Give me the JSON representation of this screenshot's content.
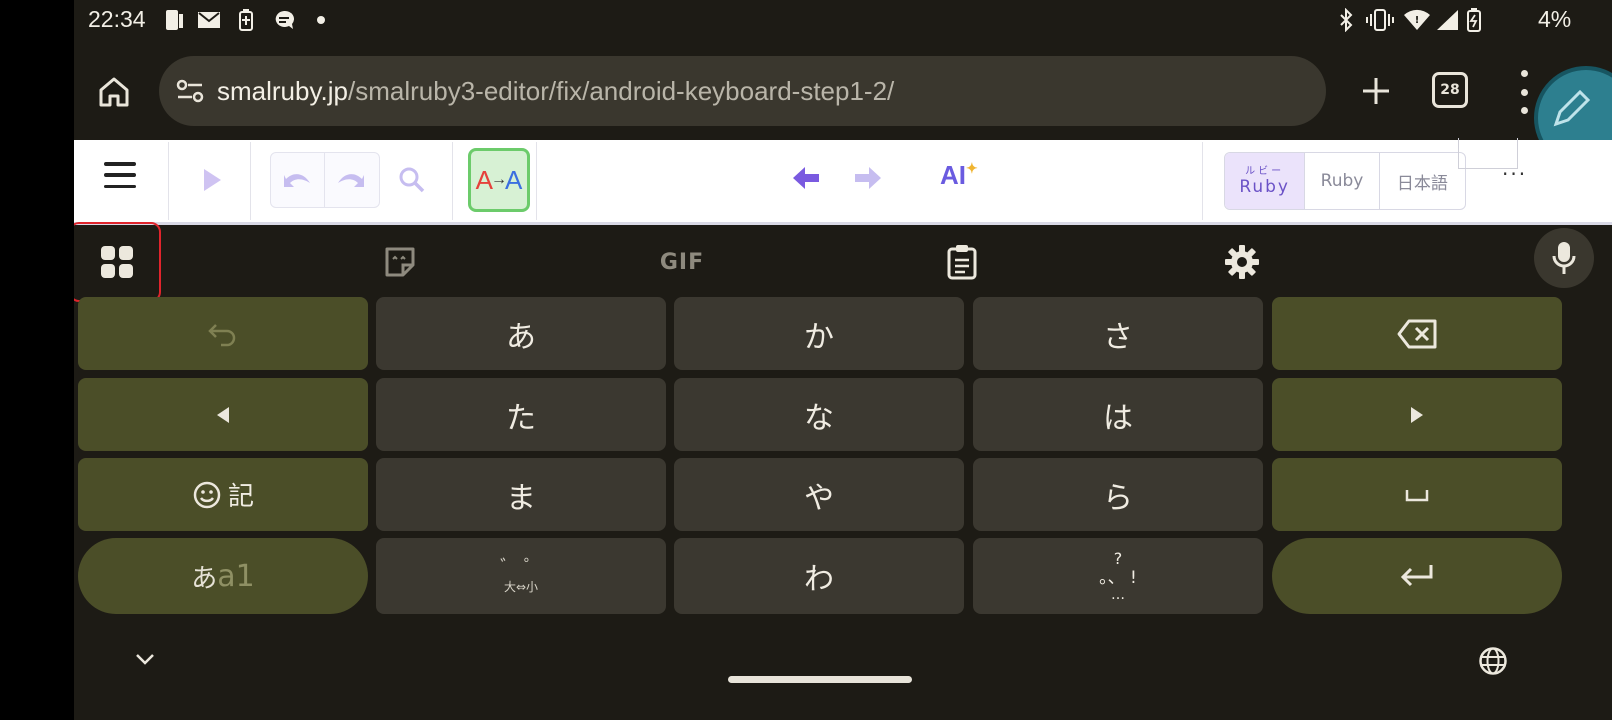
{
  "status_bar": {
    "time": "22:34",
    "battery_percent": "4%",
    "icons": [
      "phone-icon",
      "mail-icon",
      "battery-saver-icon",
      "chat-icon",
      "dot-icon",
      "bluetooth-icon",
      "vibrate-icon",
      "wifi-icon",
      "signal-icon",
      "battery-icon"
    ]
  },
  "browser": {
    "url_host": "smalruby.jp",
    "url_path": "/smalruby3-editor/fix/android-keyboard-step1-2/",
    "tab_count": "28"
  },
  "app_toolbar": {
    "aa_label_1": "A",
    "aa_label_2": "A",
    "ai_label": "AI",
    "lang_ruby_furigana": "ルビー",
    "lang_ruby_main": "Ruby",
    "lang_ruby": "Ruby",
    "lang_japanese": "日本語",
    "more_label": "···"
  },
  "keyboard": {
    "toolbar_icons": [
      "apps-grid-icon",
      "sticker-icon",
      "gif-icon",
      "clipboard-icon",
      "settings-icon",
      "mic-icon"
    ],
    "gif_label": "GIF",
    "rows": [
      [
        "↶",
        "あ",
        "か",
        "さ",
        "⌫"
      ],
      [
        "◀",
        "た",
        "な",
        "は",
        "▶"
      ],
      [
        "☺記",
        "ま",
        "や",
        "ら",
        "␣"
      ],
      [
        "あa1",
        "゛゜大⇔小",
        "わ",
        "。、?!…",
        "↵"
      ]
    ],
    "emoji_kigou": "記",
    "mode_kana": "あ",
    "mode_alpha": "a1",
    "dakuten_top": "゛ ゜",
    "dakuten_bottom": "大⇔小",
    "punct_top": "?",
    "punct_mid": "。、 !",
    "punct_bottom": "…"
  },
  "colors": {
    "keyboard_bg": "#1d1b15",
    "key_bg": "#3b3830",
    "fn_key_bg": "#4b4e28",
    "highlight": "#e0242c",
    "accent_purple": "#6a5be0"
  }
}
